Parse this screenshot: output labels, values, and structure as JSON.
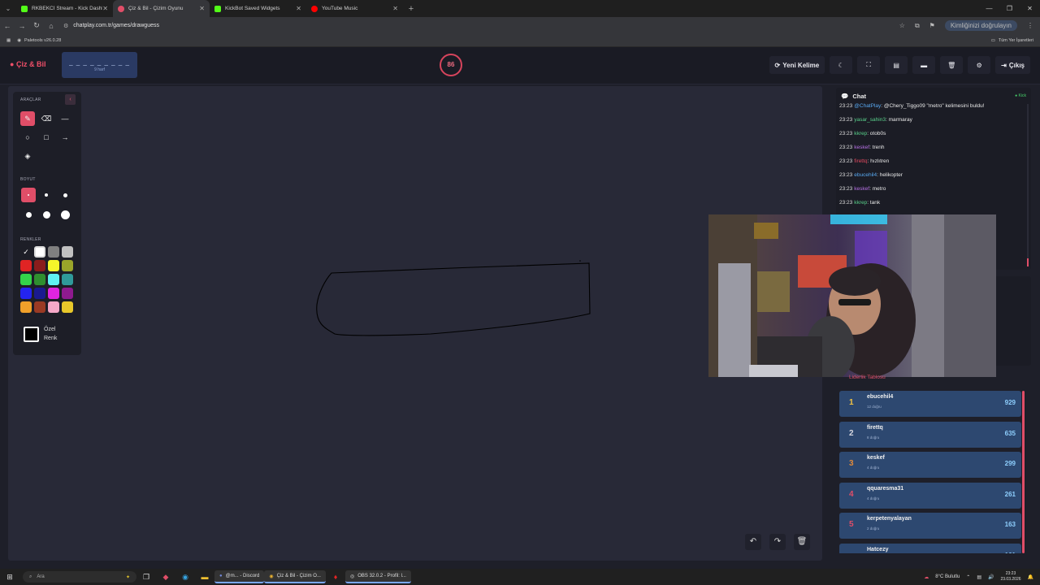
{
  "browser": {
    "tabs": [
      {
        "title": "RKBEKCİ Stream - Kick Dashbo...",
        "color": "#53fc18"
      },
      {
        "title": "Çiz & Bil - Çizim Oyunu",
        "color": "#e04e68",
        "active": true
      },
      {
        "title": "KickBot Saved Widgets",
        "color": "#53fc18"
      },
      {
        "title": "YouTube Music",
        "color": "#ff0000"
      }
    ],
    "url": "chatplay.com.tr/games/drawguess",
    "verify_label": "Kimliğinizi doğrulayın",
    "bookmark": "Paletools v26.0.28",
    "all_bookmarks": "Tüm Yer İşaretleri"
  },
  "header": {
    "logo": "Çiz & Bil",
    "word_mask": "_ _ _ _ _ _ _ _ _",
    "letter_count": "9 harf",
    "timer": "86",
    "new_word": "Yeni Kelime",
    "logout": "Çıkış"
  },
  "tools": {
    "tools_title": "ARAÇLAR",
    "size_title": "BOYUT",
    "colors_title": "RENKLER",
    "custom_color_1": "Özel",
    "custom_color_2": "Renk",
    "colors": [
      "#ffffff",
      "#ffffff",
      "#808080",
      "#c0c0c0",
      "#e02424",
      "#8a1c1c",
      "#f5f52a",
      "#9aa52a",
      "#34d34a",
      "#2f8f2f",
      "#5ff2f2",
      "#2f9a9a",
      "#2424f0",
      "#1a1a8f",
      "#e024e0",
      "#8f1a8f",
      "#f0a02a",
      "#9a3a24",
      "#f5a8c8",
      "#e8c82a"
    ]
  },
  "chat": {
    "title": "Chat",
    "platform": "Kick",
    "messages": [
      {
        "time": "23:23",
        "user": "@ChatPlay",
        "text": ": @Chery_Tiggo09 \"metro\" kelimesini buldu!",
        "cls": "u-blue"
      },
      {
        "time": "23:23",
        "user": "yasar_sahin3",
        "text": ": marmaray",
        "cls": "u-green"
      },
      {
        "time": "23:23",
        "user": "kkrep",
        "text": ": otob0s",
        "cls": "u-green"
      },
      {
        "time": "23:23",
        "user": "keskef",
        "text": ": trenh",
        "cls": "u-purple"
      },
      {
        "time": "23:23",
        "user": "firettq",
        "text": ": hızlıtren",
        "cls": "u-red"
      },
      {
        "time": "23:23",
        "user": "ebucehil4",
        "text": ": helikopter",
        "cls": "u-blue"
      },
      {
        "time": "23:23",
        "user": "keskef",
        "text": ": metro",
        "cls": "u-purple"
      },
      {
        "time": "23:23",
        "user": "kkrep",
        "text": ": tank",
        "cls": "u-green"
      }
    ]
  },
  "leaderboard": {
    "title": "Liderlik Tablosu",
    "rows": [
      {
        "rank": "1",
        "name": "ebucehil4",
        "sub": "12 doğru",
        "points": "929",
        "color": "#f5c542"
      },
      {
        "rank": "2",
        "name": "firettq",
        "sub": "8 doğru",
        "points": "635",
        "color": "#d8d8e0"
      },
      {
        "rank": "3",
        "name": "keskef",
        "sub": "4 doğru",
        "points": "299",
        "color": "#e08a3a"
      },
      {
        "rank": "4",
        "name": "qquaresma31",
        "sub": "4 doğru",
        "points": "261",
        "color": "#e04e68"
      },
      {
        "rank": "5",
        "name": "kerpetenyalayan",
        "sub": "2 doğru",
        "points": "163",
        "color": "#e04e68"
      },
      {
        "rank": "",
        "name": "Hatcezy",
        "sub": "",
        "points": "161",
        "color": "#e04e68"
      }
    ]
  },
  "taskbar": {
    "search": "Ara",
    "apps": [
      "@m... - Discord",
      "Çiz & Bil - Çizim O...",
      "OBS 32.0.2 - Profil: l..."
    ],
    "weather": "8°C Bulutlu",
    "time": "23:23",
    "date": "23.03.2026"
  }
}
